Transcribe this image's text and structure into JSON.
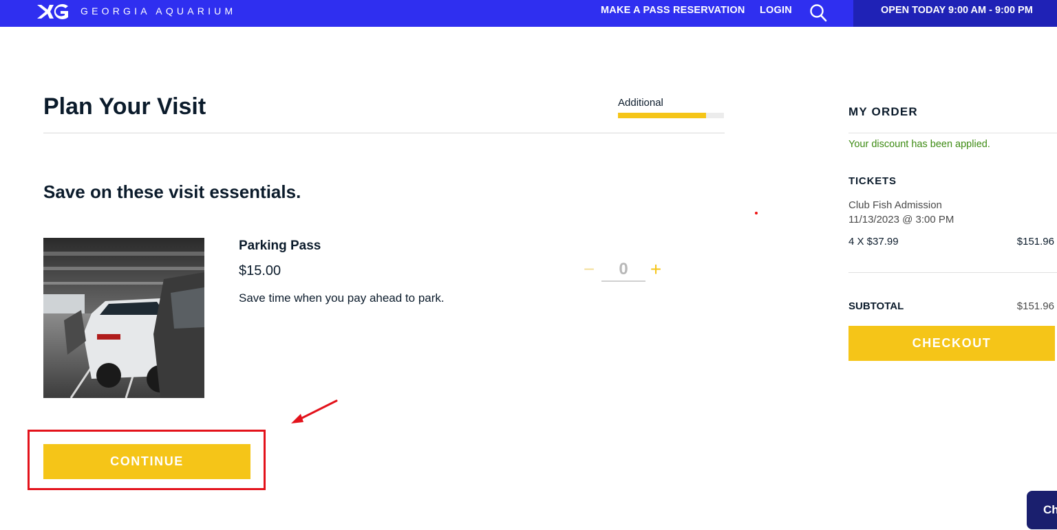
{
  "header": {
    "brand_name": "GEORGIA AQUARIUM",
    "nav": {
      "reservation": "MAKE A PASS RESERVATION",
      "login": "LOGIN"
    },
    "search_icon": "search-icon",
    "hours": "OPEN TODAY 9:00 AM - 9:00 PM",
    "colors": {
      "bar": "#2f2ff0",
      "hours_panel": "#1f22b6"
    }
  },
  "main": {
    "title": "Plan Your Visit",
    "progress": {
      "label": "Additional",
      "fraction": 0.83,
      "color": "#f5c518"
    },
    "section_heading": "Save on these visit essentials.",
    "product": {
      "name": "Parking Pass",
      "price": "$15.00",
      "description": "Save time when you pay ahead to park.",
      "quantity": {
        "minus": "−",
        "value": "0",
        "plus": "+"
      }
    },
    "continue_label": "CONTINUE"
  },
  "order": {
    "heading": "MY ORDER",
    "discount_message": "Your discount has been applied.",
    "tickets_heading": "TICKETS",
    "ticket": {
      "name": "Club Fish Admission",
      "datetime": "11/13/2023 @ 3:00 PM",
      "qty_price": "4 X $37.99",
      "total": "$151.96"
    },
    "subtotal_label": "SUBTOTAL",
    "subtotal_value": "$151.96",
    "checkout_label": "CHECKOUT"
  },
  "chat": {
    "label": "Ch"
  },
  "accent_color": "#f5c518",
  "annotation_color": "#e3121b"
}
